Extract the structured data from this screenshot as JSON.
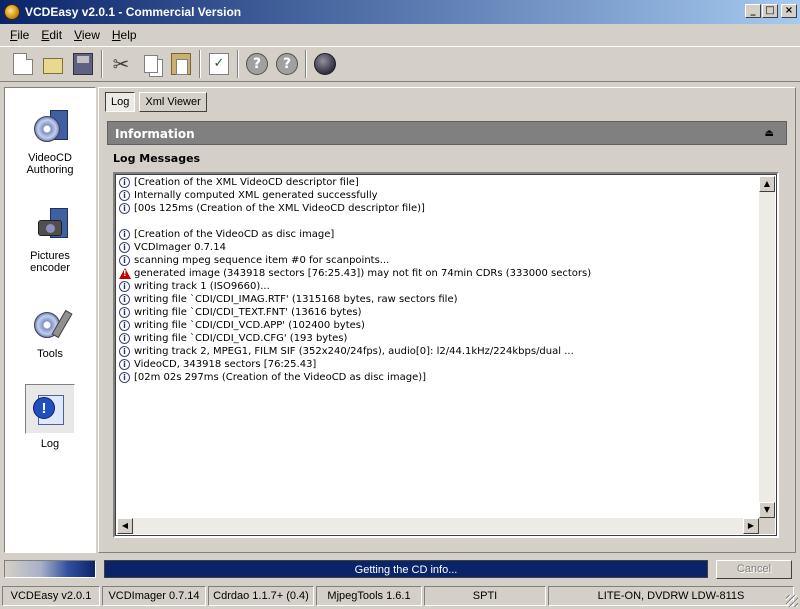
{
  "window": {
    "title": "VCDEasy v2.0.1 - Commercial Version"
  },
  "menu": {
    "items": [
      "File",
      "Edit",
      "View",
      "Help"
    ]
  },
  "toolbar": {
    "icons": [
      "new-icon",
      "open-icon",
      "save-icon",
      "cut-icon",
      "copy-icon",
      "paste-icon",
      "check-icon",
      "help-icon",
      "about-icon",
      "web-icon"
    ]
  },
  "sidebar": {
    "items": [
      {
        "label": "VideoCD Authoring",
        "line1": "VideoCD",
        "line2": "Authoring"
      },
      {
        "label": "Pictures encoder",
        "line1": "Pictures",
        "line2": "encoder"
      },
      {
        "label": "Tools",
        "line1": "Tools",
        "line2": ""
      },
      {
        "label": "Log",
        "line1": "Log",
        "line2": ""
      }
    ]
  },
  "tabs": [
    "Log",
    "Xml Viewer"
  ],
  "information": {
    "title": "Information"
  },
  "log": {
    "title": "Log Messages",
    "lines": [
      {
        "icon": "info",
        "text": "[Creation of the XML VideoCD descriptor file]"
      },
      {
        "icon": "info",
        "text": "Internally computed XML generated successfully"
      },
      {
        "icon": "info",
        "text": "[00s 125ms (Creation of the XML VideoCD descriptor file)]"
      },
      {
        "icon": "none",
        "text": ""
      },
      {
        "icon": "info",
        "text": "[Creation of the VideoCD as disc image]"
      },
      {
        "icon": "info",
        "text": "VCDImager 0.7.14"
      },
      {
        "icon": "info",
        "text": "scanning mpeg sequence item #0 for scanpoints..."
      },
      {
        "icon": "warning",
        "text": "generated image (343918 sectors [76:25.43]) may not fit on 74min CDRs (333000 sectors)"
      },
      {
        "icon": "info",
        "text": "writing track 1 (ISO9660)..."
      },
      {
        "icon": "info",
        "text": "writing file `CDI/CDI_IMAG.RTF' (1315168 bytes, raw sectors file)"
      },
      {
        "icon": "info",
        "text": "writing file `CDI/CDI_TEXT.FNT' (13616 bytes)"
      },
      {
        "icon": "info",
        "text": "writing file `CDI/CDI_VCD.APP' (102400 bytes)"
      },
      {
        "icon": "info",
        "text": "writing file `CDI/CDI_VCD.CFG' (193 bytes)"
      },
      {
        "icon": "info",
        "text": "writing track 2, MPEG1, FILM SIF (352x240/24fps), audio[0]: l2/44.1kHz/224kbps/dual ..."
      },
      {
        "icon": "info",
        "text": "VideoCD, 343918 sectors [76:25.43]"
      },
      {
        "icon": "info",
        "text": "[02m 02s 297ms (Creation of the VideoCD as disc image)]"
      }
    ]
  },
  "progress": {
    "status_text": "Getting the CD info...",
    "cancel_label": "Cancel"
  },
  "statusbar": {
    "cells": [
      "VCDEasy v2.0.1",
      "VCDImager 0.7.14",
      "Cdrdao 1.1.7+ (0.4)",
      "MjpegTools 1.6.1",
      "SPTI",
      "LITE-ON, DVDRW LDW-811S"
    ]
  },
  "colors": {
    "titlebar_start": "#0a246a",
    "titlebar_end": "#a6caf0",
    "progress": "#0a246a",
    "info_bar": "#808080",
    "warning": "#c00000"
  }
}
